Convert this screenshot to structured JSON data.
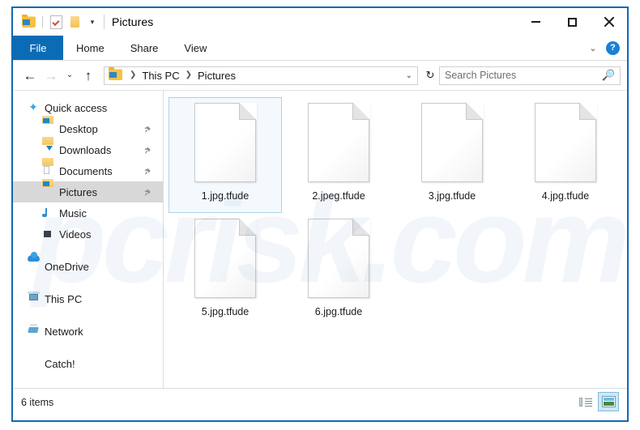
{
  "window": {
    "title": "Pictures",
    "quick_access_icons": [
      "folder-pictures-icon",
      "properties-icon",
      "new-folder-icon"
    ],
    "qat_dropdown": "▾",
    "minimize_label": "—",
    "maximize_label": "□",
    "close_label": "✕",
    "frame_color": "#1468b0"
  },
  "ribbon": {
    "file_tab": "File",
    "tabs": [
      {
        "label": "Home"
      },
      {
        "label": "Share"
      },
      {
        "label": "View"
      }
    ],
    "expand_chevron": "⌄",
    "help_label": "?",
    "file_tab_color": "#0b6cb5"
  },
  "navbar": {
    "back": "←",
    "forward": "→",
    "recent": "⌄",
    "up": "↑",
    "breadcrumb": [
      {
        "label": "This PC"
      },
      {
        "label": "Pictures"
      }
    ],
    "separator": "❯",
    "address_dropdown": "⌄",
    "refresh": "↻"
  },
  "search": {
    "placeholder": "Search Pictures",
    "icon": "search-icon"
  },
  "sidebar": {
    "quick_access": {
      "label": "Quick access",
      "icon": "star-icon"
    },
    "quick_items": [
      {
        "label": "Desktop",
        "icon": "folder-desktop-icon",
        "pinned": true
      },
      {
        "label": "Downloads",
        "icon": "folder-downloads-icon",
        "pinned": true
      },
      {
        "label": "Documents",
        "icon": "folder-documents-icon",
        "pinned": true
      },
      {
        "label": "Pictures",
        "icon": "folder-pictures-icon",
        "pinned": true,
        "selected": true
      },
      {
        "label": "Music",
        "icon": "music-icon",
        "pinned": false
      },
      {
        "label": "Videos",
        "icon": "video-icon",
        "pinned": false
      }
    ],
    "roots": [
      {
        "label": "OneDrive",
        "icon": "cloud-icon"
      },
      {
        "label": "This PC",
        "icon": "computer-icon"
      },
      {
        "label": "Network",
        "icon": "network-icon"
      },
      {
        "label": "Catch!",
        "icon": "catch-icon"
      }
    ]
  },
  "files": [
    {
      "name": "1.jpg.tfude",
      "selected": true
    },
    {
      "name": "2.jpeg.tfude",
      "selected": false
    },
    {
      "name": "3.jpg.tfude",
      "selected": false
    },
    {
      "name": "4.jpg.tfude",
      "selected": false
    },
    {
      "name": "5.jpg.tfude",
      "selected": false
    },
    {
      "name": "6.jpg.tfude",
      "selected": false
    }
  ],
  "status": {
    "item_count": "6 items",
    "view_details_icon": "details-view-icon",
    "view_large_icons_icon": "large-icons-view-icon"
  },
  "watermark": {
    "text": "pcrisk.com"
  }
}
